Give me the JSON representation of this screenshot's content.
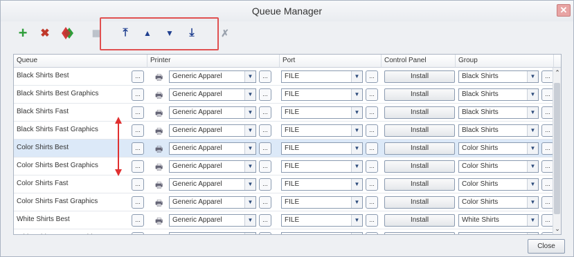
{
  "window": {
    "title": "Queue Manager",
    "close_glyph": "✕"
  },
  "toolbar": {
    "add_icon": "+",
    "delete_icon": "✖",
    "move_top_icon": "⤒",
    "move_up_icon": "▲",
    "move_down_icon": "▼",
    "move_bottom_icon": "⤓",
    "clear_icon": "✗"
  },
  "columns": {
    "queue": "Queue",
    "printer": "Printer",
    "port": "Port",
    "control_panel": "Control Panel",
    "group": "Group"
  },
  "row_buttons": {
    "ellipsis": "...",
    "install": "Install"
  },
  "rows": [
    {
      "queue": "Black Shirts Best",
      "printer": "Generic Apparel",
      "port": "FILE",
      "group": "Black Shirts"
    },
    {
      "queue": "Black Shirts Best Graphics",
      "printer": "Generic Apparel",
      "port": "FILE",
      "group": "Black Shirts"
    },
    {
      "queue": "Black Shirts Fast",
      "printer": "Generic Apparel",
      "port": "FILE",
      "group": "Black Shirts"
    },
    {
      "queue": "Black Shirts Fast Graphics",
      "printer": "Generic Apparel",
      "port": "FILE",
      "group": "Black Shirts"
    },
    {
      "queue": "Color Shirts Best",
      "printer": "Generic Apparel",
      "port": "FILE",
      "group": "Color Shirts"
    },
    {
      "queue": "Color Shirts Best Graphics",
      "printer": "Generic Apparel",
      "port": "FILE",
      "group": "Color Shirts"
    },
    {
      "queue": "Color Shirts Fast",
      "printer": "Generic Apparel",
      "port": "FILE",
      "group": "Color Shirts"
    },
    {
      "queue": "Color Shirts Fast Graphics",
      "printer": "Generic Apparel",
      "port": "FILE",
      "group": "Color Shirts"
    },
    {
      "queue": "White Shirts Best",
      "printer": "Generic Apparel",
      "port": "FILE",
      "group": "White Shirts"
    },
    {
      "queue": "White Shirts Best Graphics",
      "printer": "Generic Apparel",
      "port": "FILE",
      "group": "White Shirts"
    }
  ],
  "selected_row_index": 4,
  "footer": {
    "close_label": "Close"
  },
  "colors": {
    "accent_red": "#e05050",
    "selection": "#dce9f8",
    "add_green": "#2e9e3a",
    "delete_red": "#c0392b",
    "arrow_blue": "#1f3f8f"
  }
}
